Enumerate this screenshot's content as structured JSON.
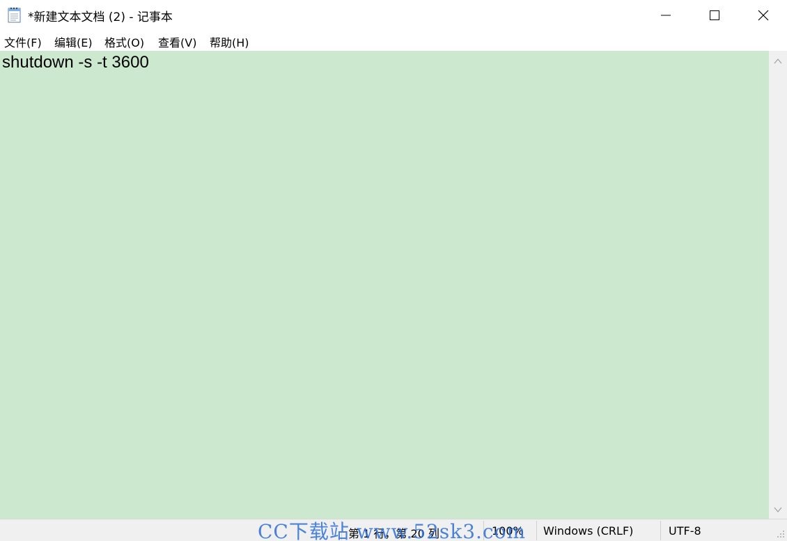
{
  "window": {
    "title": "*新建文本文档 (2) - 记事本",
    "icon": "notepad-icon"
  },
  "controls": {
    "minimize_icon": "minimize-icon",
    "maximize_icon": "maximize-icon",
    "close_icon": "close-icon"
  },
  "menu": {
    "file": "文件(F)",
    "edit": "编辑(E)",
    "format": "格式(O)",
    "view": "查看(V)",
    "help": "帮助(H)"
  },
  "editor": {
    "content": "shutdown -s -t 3600",
    "background_color": "#cce8cf"
  },
  "status": {
    "position": "第 1 行，第 20 列",
    "zoom": "100%",
    "line_ending": "Windows (CRLF)",
    "encoding": "UTF-8"
  },
  "watermark": {
    "text": "CC下载站 www.52sk3.com",
    "color": "#2f6fd6"
  }
}
